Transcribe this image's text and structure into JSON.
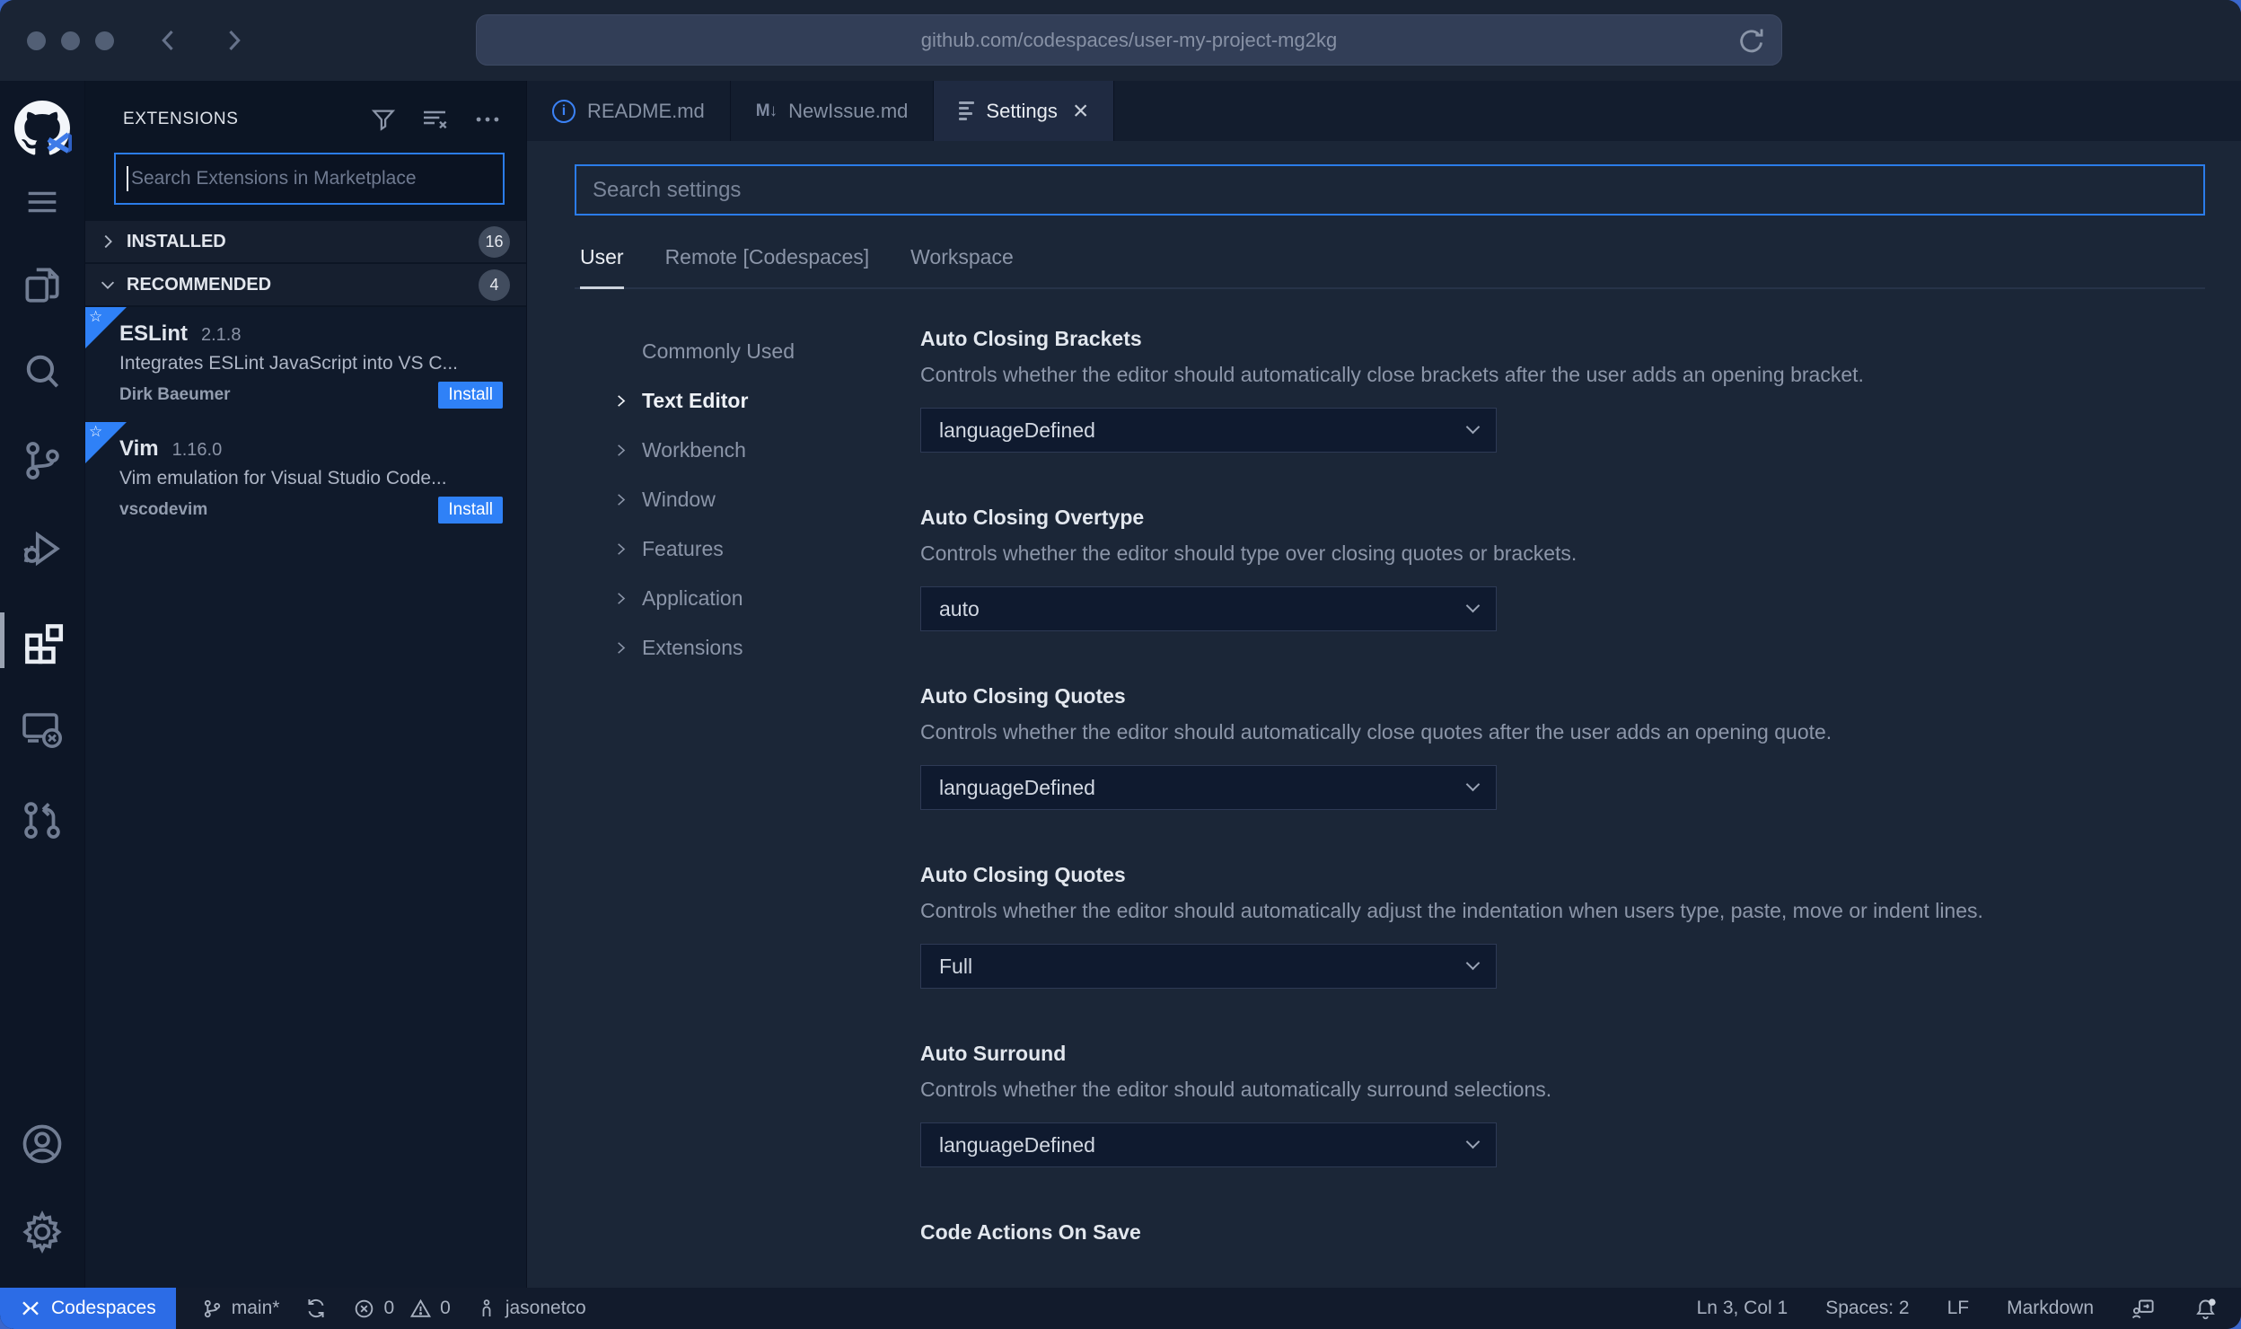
{
  "browser": {
    "url": "github.com/codespaces/user-my-project-mg2kg"
  },
  "sidebar": {
    "title": "EXTENSIONS",
    "search_placeholder": "Search Extensions in Marketplace",
    "sections": [
      {
        "label": "INSTALLED",
        "count": "16"
      },
      {
        "label": "RECOMMENDED",
        "count": "4"
      }
    ],
    "extensions": [
      {
        "name": "ESLint",
        "version": "2.1.8",
        "description": "Integrates ESLint JavaScript into VS C...",
        "publisher": "Dirk Baeumer",
        "action_label": "Install"
      },
      {
        "name": "Vim",
        "version": "1.16.0",
        "description": "Vim emulation for Visual Studio Code...",
        "publisher": "vscodevim",
        "action_label": "Install"
      }
    ]
  },
  "tabs": [
    {
      "label": "README.md",
      "icon": "info-icon"
    },
    {
      "label": "NewIssue.md",
      "icon_text": "M↓"
    },
    {
      "label": "Settings",
      "icon": "settings-list-icon",
      "active": true
    }
  ],
  "settings": {
    "search_placeholder": "Search settings",
    "scopes": [
      "User",
      "Remote [Codespaces]",
      "Workspace"
    ],
    "active_scope": "User",
    "toc": [
      "Commonly Used",
      "Text Editor",
      "Workbench",
      "Window",
      "Features",
      "Application",
      "Extensions"
    ],
    "active_toc": "Text Editor",
    "entries": [
      {
        "title": "Auto Closing Brackets",
        "description": "Controls whether the editor should automatically close brackets after the user adds an opening bracket.",
        "value": "languageDefined"
      },
      {
        "title": "Auto Closing Overtype",
        "description": "Controls whether the editor should type over closing quotes or brackets.",
        "value": "auto"
      },
      {
        "title": "Auto Closing Quotes",
        "description": "Controls whether the editor should automatically close quotes after the user adds an opening quote.",
        "value": "languageDefined"
      },
      {
        "title": "Auto Closing Quotes",
        "description": "Controls whether the editor should automatically adjust the indentation when users type, paste, move or indent lines.",
        "value": "Full"
      },
      {
        "title": "Auto Surround",
        "description": "Controls whether the editor should automatically surround selections.",
        "value": "languageDefined"
      },
      {
        "title": "Code Actions On Save"
      }
    ]
  },
  "statusbar": {
    "remote_label": "Codespaces",
    "branch": "main*",
    "errors": "0",
    "warnings": "0",
    "user": "jasonetco",
    "cursor": "Ln 3, Col 1",
    "indent": "Spaces: 2",
    "eol": "LF",
    "language": "Markdown"
  },
  "colors": {
    "accent": "#2b7ce9",
    "install_button": "#2f81f7",
    "codespaces_badge": "#2c6ce6"
  }
}
